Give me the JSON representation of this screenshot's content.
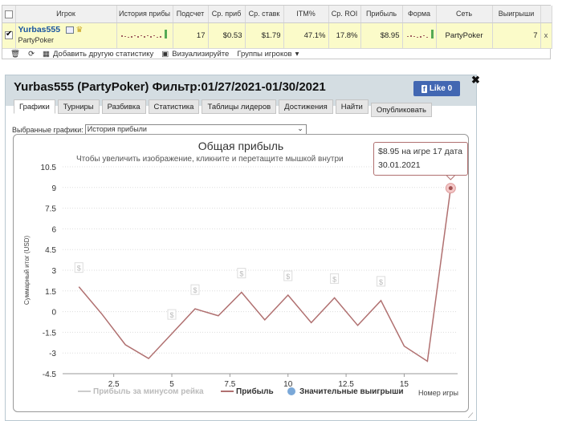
{
  "stats_table": {
    "columns": [
      "Игрок",
      "История прибы",
      "Подсчет",
      "Ср. приб",
      "Ср. ставк",
      "ITM%",
      "Ср. ROI",
      "Прибыль",
      "Форма",
      "Сеть",
      "Выигрыши"
    ],
    "row": {
      "player": "Yurbas555",
      "network_sub": "PartyPoker",
      "count": "17",
      "avg_profit": "$0.53",
      "avg_stake": "$1.79",
      "itm": "47.1%",
      "roi": "17.8%",
      "profit": "$8.95",
      "network": "PartyPoker",
      "wins": "7"
    },
    "toolbar": {
      "add_stats": "Добавить другую статистику",
      "visualize": "Визуализируйте",
      "groups": "Группы игроков"
    }
  },
  "panel": {
    "title": "Yurbas555 (PartyPoker) Фильтр:01/27/2021-01/30/2021",
    "like": "Like 0",
    "tabs": [
      "Графики",
      "Турниры",
      "Разбивка",
      "Статистика",
      "Таблицы лидеров",
      "Достижения",
      "Найти"
    ],
    "publish_tab": "Опубликовать",
    "selected_label": "Выбранные графики:",
    "selected_value": "История прибыли"
  },
  "chart_data": {
    "type": "line",
    "title": "Общая прибыль",
    "subtitle": "Чтобы увеличить изображение, кликните и перетащите мышкой внутри",
    "ylabel": "Суммарный итог (USD)",
    "xlabel": "Номер игры",
    "x": [
      1,
      2,
      3,
      4,
      5,
      6,
      7,
      8,
      9,
      10,
      11,
      12,
      13,
      14,
      15,
      16,
      17
    ],
    "y": [
      1.8,
      -0.2,
      -2.4,
      -3.4,
      -1.6,
      0.2,
      -0.3,
      1.4,
      -0.6,
      1.2,
      -0.8,
      1.0,
      -1.0,
      0.8,
      -2.5,
      -3.6,
      8.95
    ],
    "xlim": [
      0.3,
      17.3
    ],
    "ylim": [
      -4.5,
      10.5
    ],
    "yticks": [
      "10.5",
      "9",
      "7.5",
      "6",
      "4.5",
      "3",
      "1.5",
      "0",
      "-1.5",
      "-3",
      "-4.5"
    ],
    "xticks": [
      "2.5",
      "5",
      "7.5",
      "10",
      "12.5",
      "15"
    ],
    "big_wins_markers": [
      1,
      5,
      6,
      8,
      10,
      12,
      14
    ],
    "legend": [
      "Прибыль за минусом рейка",
      "Прибыль",
      "Значительные выигрыши"
    ],
    "tooltip": [
      "$8.95 на игре 17 дата",
      "30.01.2021"
    ],
    "colors": {
      "line": "#b07070",
      "legend_bw": "#7aa8d8",
      "grid": "#dddddd"
    }
  }
}
